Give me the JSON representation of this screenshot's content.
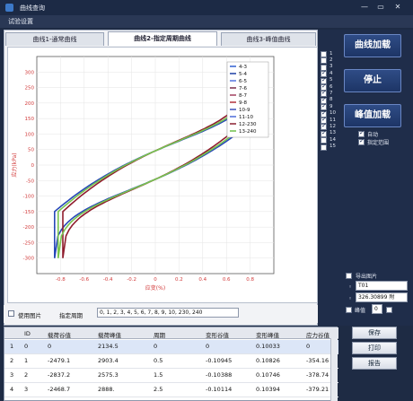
{
  "window": {
    "title": "曲线查询",
    "controls": [
      "—",
      "▭",
      "✕"
    ]
  },
  "menu": {
    "items": [
      "试验设置"
    ]
  },
  "tabs": [
    {
      "label": "曲线1-通常曲线",
      "active": false
    },
    {
      "label": "曲线2-指定周期曲线",
      "active": true
    },
    {
      "label": "曲线3-峰值曲线",
      "active": false
    }
  ],
  "chart_data": {
    "type": "line",
    "ylabel": "应力(kPa)",
    "xlabel": "应变(%)",
    "xlim": [
      -1.0,
      1.0
    ],
    "ylim": [
      -350,
      350
    ],
    "x_ticks": [
      "-0.8",
      "-0.6",
      "-0.4",
      "-0.2",
      "0",
      "0.2",
      "0.4",
      "0.6",
      "0.8"
    ],
    "y_ticks": [
      "300",
      "250",
      "200",
      "150",
      "100",
      "50",
      "0",
      "-50",
      "-100",
      "-150",
      "-200",
      "-250",
      "-300"
    ],
    "legend_placement": "top-right",
    "series": [
      {
        "name": "4-3",
        "color": "#2f5fd0"
      },
      {
        "name": "5-4",
        "color": "#1e3fa6"
      },
      {
        "name": "6-5",
        "color": "#5575e0"
      },
      {
        "name": "7-6",
        "color": "#7a2d4a"
      },
      {
        "name": "8-7",
        "color": "#a24060"
      },
      {
        "name": "9-8",
        "color": "#b0303a"
      },
      {
        "name": "10-9",
        "color": "#3a4fb8"
      },
      {
        "name": "11-10",
        "color": "#4c6ad8"
      },
      {
        "name": "12-230",
        "color": "#8a2030"
      },
      {
        "name": "13-240",
        "color": "#6fbf4a"
      }
    ],
    "loops": [
      {
        "name": "blue",
        "color": "#2848b8",
        "width": 0.85
      },
      {
        "name": "red",
        "color": "#8f1c2c",
        "width": 0.78
      },
      {
        "name": "green",
        "color": "#78c44e",
        "width": 0.82
      }
    ]
  },
  "side_checkboxes": [
    {
      "n": "1",
      "on": false
    },
    {
      "n": "2",
      "on": false
    },
    {
      "n": "3",
      "on": false
    },
    {
      "n": "4",
      "on": true
    },
    {
      "n": "5",
      "on": true
    },
    {
      "n": "6",
      "on": true
    },
    {
      "n": "7",
      "on": true
    },
    {
      "n": "8",
      "on": true
    },
    {
      "n": "9",
      "on": true
    },
    {
      "n": "10",
      "on": true
    },
    {
      "n": "11",
      "on": true
    },
    {
      "n": "12",
      "on": true
    },
    {
      "n": "13",
      "on": true
    },
    {
      "n": "14",
      "on": false
    },
    {
      "n": "15",
      "on": false
    }
  ],
  "sidebar": {
    "load_curve": "曲线加载",
    "stop": "停止",
    "peak_load": "峰值加载",
    "opt_auto": "自动",
    "opt_range": "指定范围",
    "export_label": "导出图片",
    "value1": "T01",
    "value2": "326.30899 附",
    "flag_label": "峰值",
    "flag_value": "0"
  },
  "bottom": {
    "use_image_label": "使用图片",
    "cycle_label": "指定周期",
    "cycle_value": "0, 1, 2, 3, 4, 5, 6, 7, 8, 9, 10, 230, 240"
  },
  "table": {
    "headers": [
      "ID",
      "载荷谷值",
      "载荷峰值",
      "周期",
      "变形谷值",
      "变形峰值",
      "应力谷值"
    ],
    "rows": [
      [
        "0",
        "0",
        "2134.5",
        "0",
        "0",
        "0.10033",
        "0"
      ],
      [
        "1",
        "-2479.1",
        "2903.4",
        "0.5",
        "-0.10945",
        "0.10826",
        "-354.16"
      ],
      [
        "2",
        "-2837.2",
        "2575.3",
        "1.5",
        "-0.10388",
        "0.10746",
        "-378.74"
      ],
      [
        "3",
        "-2468.7",
        "2888.",
        "2.5",
        "-0.10114",
        "0.10394",
        "-379.21"
      ]
    ]
  },
  "right_buttons": {
    "save": "保存",
    "print": "打印",
    "report": "报告"
  }
}
